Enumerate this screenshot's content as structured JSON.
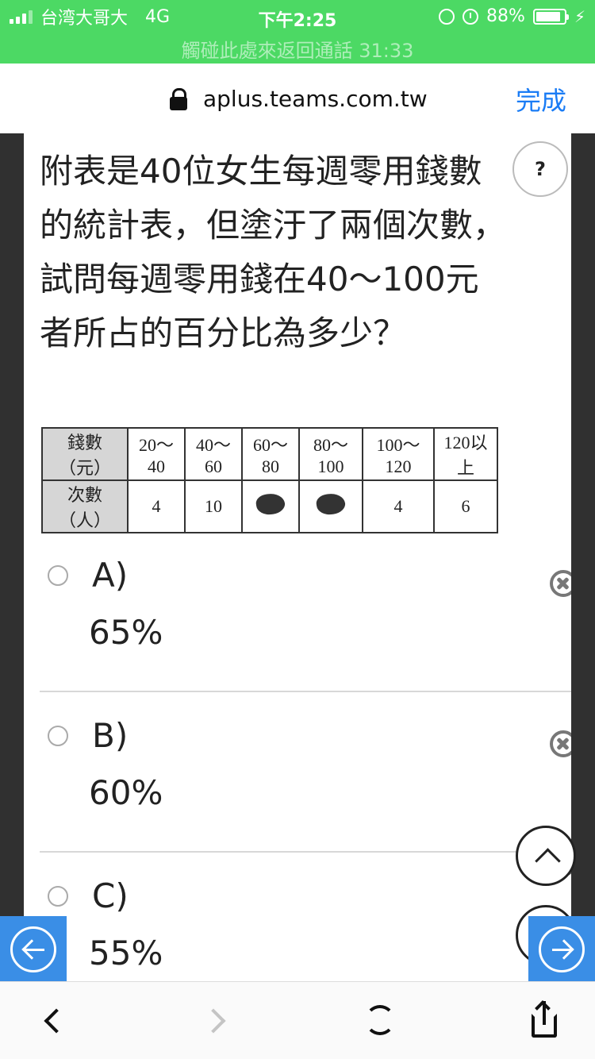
{
  "status_bar": {
    "carrier": "台湾大哥大",
    "network": "4G",
    "time": "下午2:25",
    "battery": "88%",
    "battery_level": 0.88,
    "call_banner": "觸碰此處來返回通話 31:33",
    "icons": [
      "signal-icon",
      "rotation-lock-icon",
      "alarm-icon",
      "battery-icon",
      "charging-icon"
    ]
  },
  "browser": {
    "url": "aplus.teams.com.tw",
    "done_label": "完成",
    "toolbar_icons": [
      "back-icon",
      "forward-icon",
      "reload-icon",
      "share-icon"
    ]
  },
  "question": {
    "text": "附表是40位女生每週零用錢數的統計表，但塗汙了兩個次數，試問每週零用錢在40～100元者所占的百分比為多少？",
    "help_label": "?"
  },
  "table": {
    "row_headers": [
      "錢數（元）",
      "次數（人）"
    ],
    "ranges": [
      "20～40",
      "40～60",
      "60～80",
      "80～100",
      "100～120",
      "120以上"
    ],
    "counts": [
      "4",
      "10",
      "",
      "",
      "4",
      "6"
    ]
  },
  "options": [
    {
      "letter": "A)",
      "value": "65%"
    },
    {
      "letter": "B)",
      "value": "60%"
    },
    {
      "letter": "C)",
      "value": "55%"
    }
  ],
  "colors": {
    "status_green": "#4cd964",
    "link_blue": "#1a7cf5",
    "nav_blue": "#3a8ee6",
    "frame": "#303030"
  }
}
